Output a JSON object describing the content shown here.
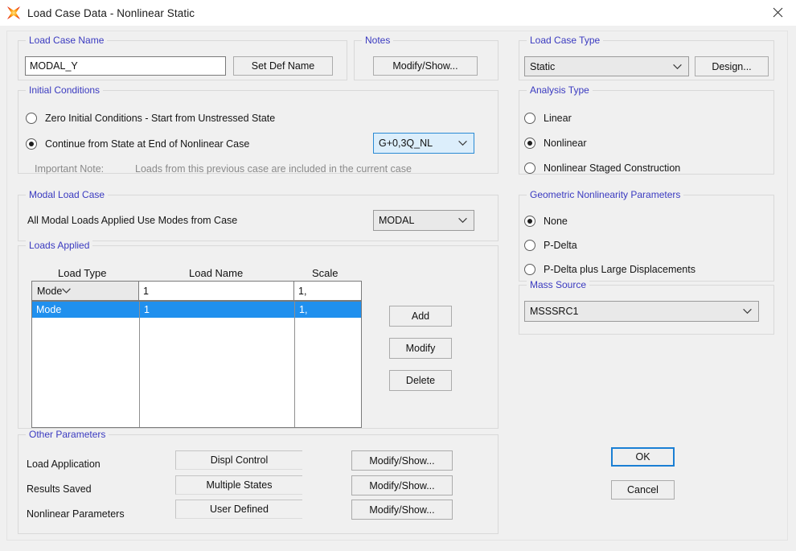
{
  "window": {
    "title": "Load Case Data - Nonlinear Static",
    "app_icon": "sap2000-star-icon",
    "close_icon": "close-icon"
  },
  "load_case_name": {
    "legend": "Load Case Name",
    "value": "MODAL_Y",
    "set_def_name_label": "Set Def Name"
  },
  "notes": {
    "legend": "Notes",
    "modify_show_label": "Modify/Show..."
  },
  "load_case_type": {
    "legend": "Load Case Type",
    "selected": "Static",
    "design_label": "Design..."
  },
  "initial_conditions": {
    "legend": "Initial Conditions",
    "option_zero": "Zero Initial Conditions - Start from Unstressed State",
    "option_continue": "Continue from State at End of Nonlinear Case",
    "selected": "continue",
    "case_combo": "G+0,3Q_NL",
    "note_label": "Important Note:",
    "note_text": "Loads from this previous case are included in the current case"
  },
  "analysis_type": {
    "legend": "Analysis Type",
    "options": [
      "Linear",
      "Nonlinear",
      "Nonlinear Staged Construction"
    ],
    "selected_index": 1
  },
  "modal_load_case": {
    "legend": "Modal Load Case",
    "label": "All Modal Loads Applied Use Modes from Case",
    "selected": "MODAL"
  },
  "geometric_nonlinearity": {
    "legend": "Geometric Nonlinearity Parameters",
    "options": [
      "None",
      "P-Delta",
      "P-Delta plus Large Displacements"
    ],
    "selected_index": 0
  },
  "loads_applied": {
    "legend": "Loads Applied",
    "columns": [
      "Load Type",
      "Load Name",
      "Scale"
    ],
    "edit_row": {
      "load_type": "Mode",
      "load_name": "1",
      "scale": "1,"
    },
    "rows": [
      {
        "load_type": "Mode",
        "load_name": "1",
        "scale": "1,"
      }
    ],
    "buttons": {
      "add": "Add",
      "modify": "Modify",
      "delete": "Delete"
    }
  },
  "mass_source": {
    "legend": "Mass Source",
    "selected": "MSSSRC1"
  },
  "other_parameters": {
    "legend": "Other Parameters",
    "rows": [
      {
        "label": "Load Application",
        "value": "Displ Control",
        "button": "Modify/Show..."
      },
      {
        "label": "Results Saved",
        "value": "Multiple States",
        "button": "Modify/Show..."
      },
      {
        "label": "Nonlinear Parameters",
        "value": "User Defined",
        "button": "Modify/Show..."
      }
    ]
  },
  "dialog_buttons": {
    "ok": "OK",
    "cancel": "Cancel"
  },
  "colors": {
    "legend_blue": "#3a3ac0",
    "selection_blue": "#2090ee",
    "focus_blue": "#1a7fd4",
    "dialog_face": "#f0f0f0"
  }
}
